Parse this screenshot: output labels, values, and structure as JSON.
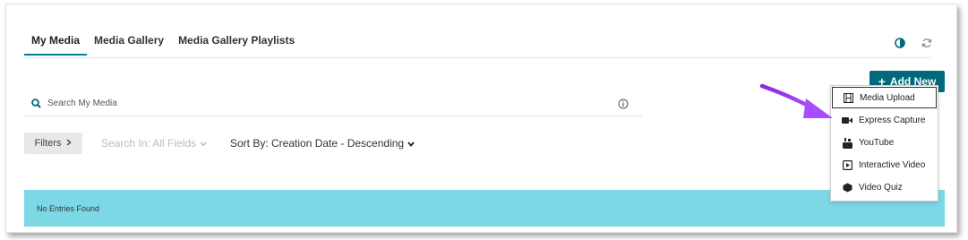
{
  "tabs": [
    {
      "label": "My Media",
      "active": true
    },
    {
      "label": "Media Gallery",
      "active": false
    },
    {
      "label": "Media Gallery Playlists",
      "active": false
    }
  ],
  "add_new": {
    "label": "Add New"
  },
  "search": {
    "placeholder": "Search My Media"
  },
  "filters": {
    "button_label": "Filters",
    "search_in": "Search In: All Fields",
    "sort_by": "Sort By: Creation Date - Descending"
  },
  "banner": {
    "text": "No Entries Found"
  },
  "dropdown": {
    "items": [
      {
        "label": "Media Upload",
        "icon": "film-icon",
        "selected": true
      },
      {
        "label": "Express Capture",
        "icon": "video-camera-icon",
        "selected": false
      },
      {
        "label": "YouTube",
        "icon": "youtube-icon",
        "selected": false
      },
      {
        "label": "Interactive Video",
        "icon": "play-square-icon",
        "selected": false
      },
      {
        "label": "Video Quiz",
        "icon": "cube-icon",
        "selected": false
      }
    ]
  },
  "colors": {
    "accent": "#008297",
    "add_new_bg": "#006a7a",
    "banner_bg": "#7dd8e6",
    "arrow": "#9b30ff"
  }
}
